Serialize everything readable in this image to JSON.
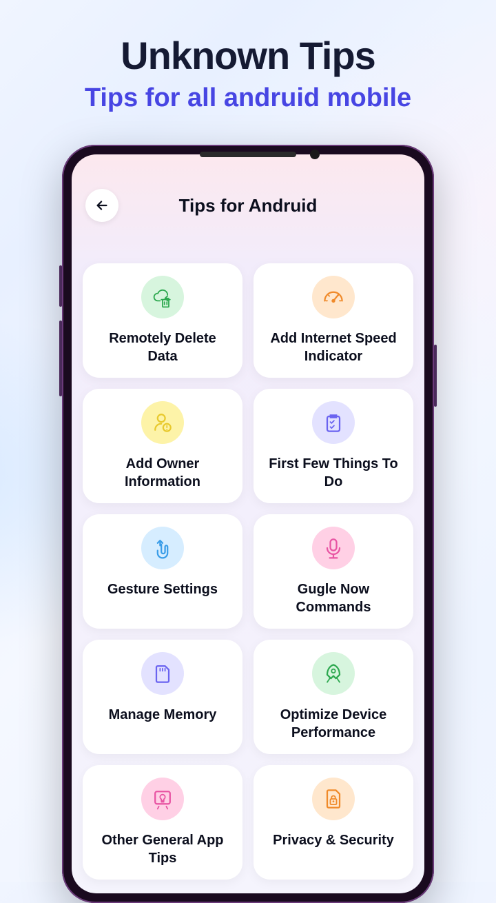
{
  "header": {
    "title": "Unknown Tips",
    "subtitle": "Tips for all andruid mobile"
  },
  "app": {
    "title": "Tips for Andruid"
  },
  "tips": [
    {
      "label": "Remotely Delete Data",
      "icon": "cloud-delete",
      "bg": "#d7f5de",
      "fg": "#2da84f"
    },
    {
      "label": "Add Internet Speed Indicator",
      "icon": "gauge",
      "bg": "#ffe7cd",
      "fg": "#f08a2a"
    },
    {
      "label": "Add Owner Information",
      "icon": "user-info",
      "bg": "#fdf3a8",
      "fg": "#e8c92d"
    },
    {
      "label": "First Few Things To Do",
      "icon": "checklist",
      "bg": "#e3e2ff",
      "fg": "#6a63f0"
    },
    {
      "label": "Gesture Settings",
      "icon": "gesture",
      "bg": "#d6edff",
      "fg": "#3a9de8"
    },
    {
      "label": "Gugle Now Commands",
      "icon": "mic",
      "bg": "#ffd0e5",
      "fg": "#e854a3"
    },
    {
      "label": "Manage Memory",
      "icon": "sdcard",
      "bg": "#e3e2ff",
      "fg": "#6a63f0"
    },
    {
      "label": "Optimize Device Performance",
      "icon": "rocket",
      "bg": "#d7f5de",
      "fg": "#2da84f"
    },
    {
      "label": "Other General App Tips",
      "icon": "lightbulb",
      "bg": "#ffd0e5",
      "fg": "#e854a3"
    },
    {
      "label": "Privacy & Security",
      "icon": "lock-file",
      "bg": "#ffe7cd",
      "fg": "#f08a2a"
    }
  ]
}
